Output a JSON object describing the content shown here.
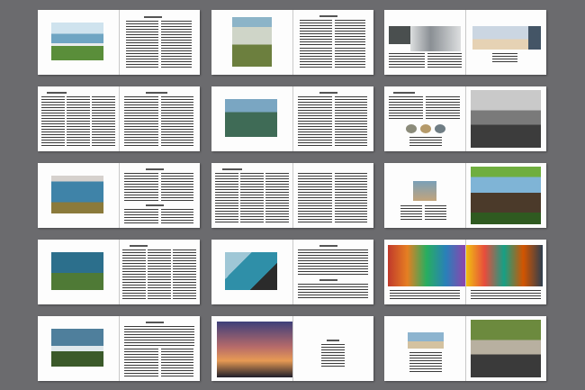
{
  "view": "spread-thumbnails",
  "columns": 3,
  "rows": 5,
  "colors": {
    "canvas": "#6b6b6e",
    "page": "#fdfdfd",
    "text_block": "#3a3a3a"
  },
  "spreads": [
    {
      "left": "photo-beach-palms",
      "right": "text-columns"
    },
    {
      "left": "photo-flowers-field",
      "right": "text-columns"
    },
    {
      "left": "photo-collage-van",
      "right": "photo-sunset-beach"
    },
    {
      "left": "text-columns",
      "right": "text-columns"
    },
    {
      "left": "photo-coastline",
      "right": "text-columns"
    },
    {
      "left": "text-with-small-photos",
      "right": "photo-bw-car"
    },
    {
      "left": "photo-wave",
      "right": "text-columns"
    },
    {
      "left": "text-columns",
      "right": "text-columns"
    },
    {
      "left": "photo-surfer-small",
      "right": "photo-horse-rider"
    },
    {
      "left": "photo-green-wave",
      "right": "text-columns"
    },
    {
      "left": "photo-wave-barrel",
      "right": "text-columns"
    },
    {
      "left": "photo-colorful-collage",
      "right": "photo-colorful-collage"
    },
    {
      "left": "photo-rocky-shore",
      "right": "text-columns"
    },
    {
      "left": "photo-street-lamp-sunset",
      "right": "text-centered"
    },
    {
      "left": "photo-coastal-scene",
      "right": "photo-bikes"
    }
  ]
}
